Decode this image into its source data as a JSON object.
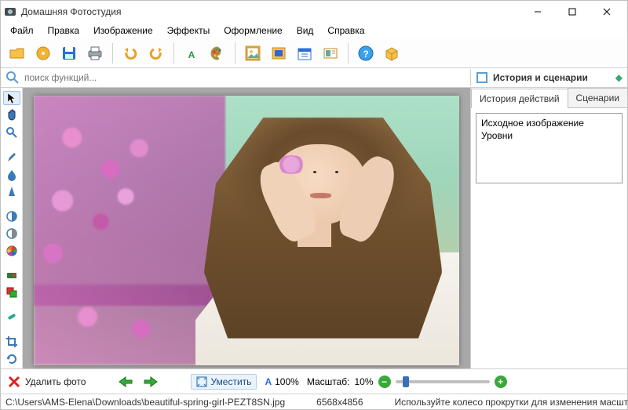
{
  "app": {
    "title": "Домашняя Фотостудия"
  },
  "menu": [
    "Файл",
    "Правка",
    "Изображение",
    "Эффекты",
    "Оформление",
    "Вид",
    "Справка"
  ],
  "search": {
    "placeholder": "поиск функций..."
  },
  "panel": {
    "title": "История и сценарии",
    "tabs": {
      "history": "История действий",
      "scenarios": "Сценарии"
    },
    "history_items": [
      "Исходное изображение",
      "Уровни"
    ]
  },
  "bottom": {
    "delete": "Удалить фото",
    "fit": "Уместить",
    "zoom100": "100%",
    "scale_label": "Масштаб:",
    "scale_value": "10%"
  },
  "status": {
    "path": "C:\\Users\\AMS-Elena\\Downloads\\beautiful-spring-girl-PEZT8SN.jpg",
    "dims": "6568x4856",
    "hint": "Используйте колесо прокрутки для изменения масштаба"
  }
}
